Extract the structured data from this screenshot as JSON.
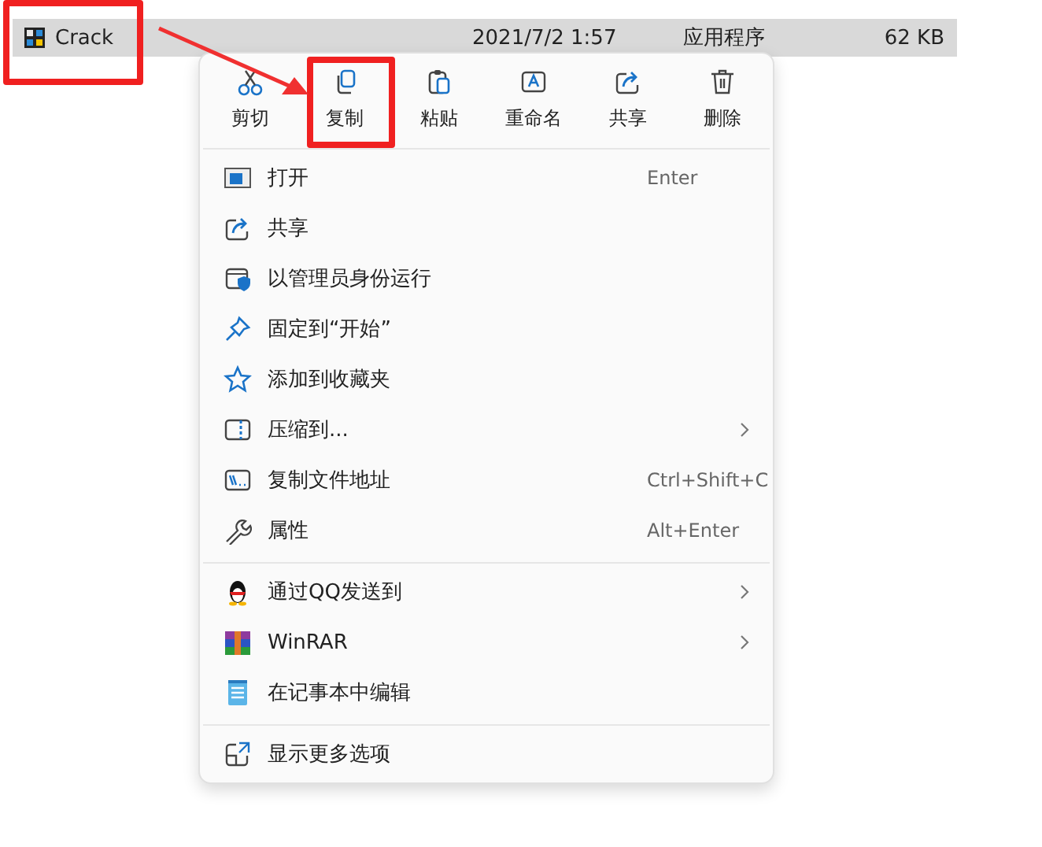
{
  "file_row": {
    "name": "Crack",
    "date": "2021/7/2 1:57",
    "type": "应用程序",
    "size": "62 KB"
  },
  "context_menu": {
    "toolbar": [
      {
        "label": "剪切"
      },
      {
        "label": "复制"
      },
      {
        "label": "粘贴"
      },
      {
        "label": "重命名"
      },
      {
        "label": "共享"
      },
      {
        "label": "删除"
      }
    ],
    "groups": [
      {
        "items": [
          {
            "label": "打开",
            "shortcut": "Enter",
            "submenu": false
          },
          {
            "label": "共享",
            "submenu": false
          },
          {
            "label": "以管理员身份运行",
            "submenu": false
          },
          {
            "label": "固定到“开始”",
            "submenu": false
          },
          {
            "label": "添加到收藏夹",
            "submenu": false
          },
          {
            "label": "压缩到...",
            "submenu": true
          },
          {
            "label": "复制文件地址",
            "shortcut": "Ctrl+Shift+C",
            "submenu": false
          },
          {
            "label": "属性",
            "shortcut": "Alt+Enter",
            "submenu": false
          }
        ]
      },
      {
        "items": [
          {
            "label": "通过QQ发送到",
            "submenu": true
          },
          {
            "label": "WinRAR",
            "submenu": true
          },
          {
            "label": "在记事本中编辑",
            "submenu": false
          }
        ]
      },
      {
        "items": [
          {
            "label": "显示更多选项",
            "submenu": false
          }
        ]
      }
    ]
  }
}
